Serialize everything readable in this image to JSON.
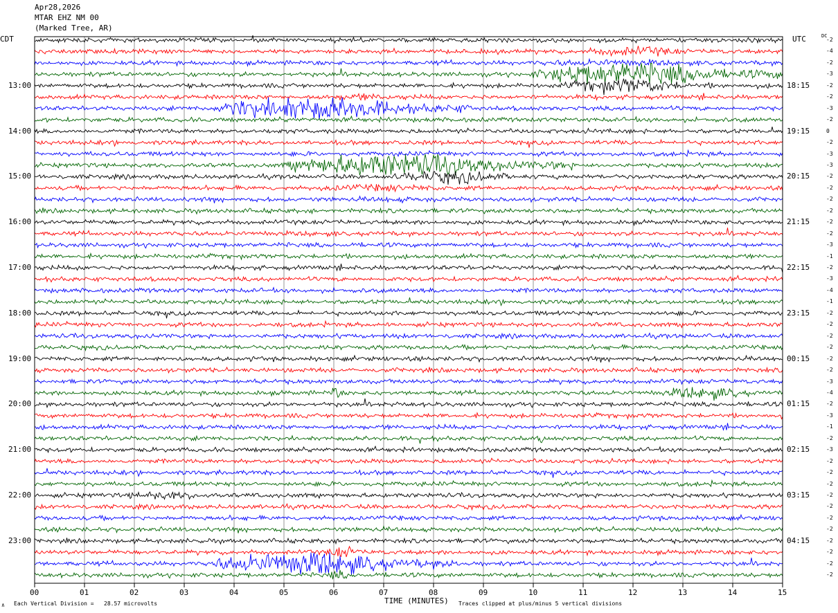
{
  "header": {
    "date": "Apr28,2026",
    "station": "MTAR EHZ NM 00",
    "location": "(Marked Tree, AR)"
  },
  "left_tz": "CDT",
  "right_tz": "UTC",
  "dc_label": "DC",
  "footer": {
    "scale_note": "Each Vertical Division =   28.57 microvolts",
    "clip_note": "Traces clipped at plus/minus 5 vertical divisions",
    "corner_mark": "∧"
  },
  "colors": {
    "black": "#000000",
    "red": "#ff0000",
    "blue": "#0000ff",
    "green": "#006400",
    "grid": "#7a7a7a"
  },
  "chart_data": {
    "type": "line",
    "title": "MTAR EHZ NM 00 helicorder, Apr28,2026",
    "xlabel": "TIME (MINUTES)",
    "ylabel": "",
    "xlim": [
      0,
      15
    ],
    "x_ticks": [
      "00",
      "01",
      "02",
      "03",
      "04",
      "05",
      "06",
      "07",
      "08",
      "09",
      "10",
      "11",
      "12",
      "13",
      "14",
      "15"
    ],
    "trace_color_cycle": [
      "black",
      "red",
      "blue",
      "green"
    ],
    "left_hour_labels": [
      "13:00",
      "14:00",
      "15:00",
      "16:00",
      "17:00",
      "18:00",
      "19:00",
      "20:00",
      "21:00",
      "22:00",
      "23:00"
    ],
    "right_hour_labels": [
      "18:15",
      "19:15",
      "20:15",
      "21:15",
      "22:15",
      "23:15",
      "00:15",
      "01:15",
      "02:15",
      "03:15",
      "04:15"
    ],
    "dc_offsets": [
      -2,
      -4,
      -2,
      -3,
      -2,
      -2,
      -3,
      -2,
      0,
      -2,
      -3,
      -3,
      -2,
      -2,
      -2,
      -2,
      -2,
      -2,
      -3,
      -1,
      -2,
      -3,
      -4,
      -1,
      -2,
      -2,
      -2,
      -2,
      -2,
      -2,
      -3,
      -4,
      -2,
      -3,
      -1,
      -2,
      -3,
      -2,
      -2,
      -2,
      -2,
      -2,
      -2,
      -2,
      -2,
      -2,
      -2,
      -2
    ],
    "events": [
      {
        "trace": 3,
        "start_min": 10.0,
        "end_min": 15.0,
        "amplitude_div": 5
      },
      {
        "trace": 4,
        "start_min": 10.5,
        "end_min": 14.0,
        "amplitude_div": 3
      },
      {
        "trace": 1,
        "start_min": 10.8,
        "end_min": 14.0,
        "amplitude_div": 2
      },
      {
        "trace": 2,
        "start_min": 9.5,
        "end_min": 14.5,
        "amplitude_div": 1.5
      },
      {
        "trace": 6,
        "start_min": 3.5,
        "end_min": 8.8,
        "amplitude_div": 5
      },
      {
        "trace": 5,
        "start_min": 5.5,
        "end_min": 8.5,
        "amplitude_div": 1.5
      },
      {
        "trace": 11,
        "start_min": 5.0,
        "end_min": 10.8,
        "amplitude_div": 5
      },
      {
        "trace": 12,
        "start_min": 7.0,
        "end_min": 10.5,
        "amplitude_div": 2.5
      },
      {
        "trace": 13,
        "start_min": 5.0,
        "end_min": 10.0,
        "amplitude_div": 1.5
      },
      {
        "trace": 14,
        "start_min": 6.0,
        "end_min": 9.5,
        "amplitude_div": 1.2
      },
      {
        "trace": 31,
        "start_min": 12.5,
        "end_min": 15.0,
        "amplitude_div": 2.5
      },
      {
        "trace": 31,
        "start_min": 5.9,
        "end_min": 6.2,
        "amplitude_div": 3
      },
      {
        "trace": 35,
        "start_min": 10.1,
        "end_min": 10.3,
        "amplitude_div": 2
      },
      {
        "trace": 40,
        "start_min": 1.6,
        "end_min": 4.2,
        "amplitude_div": 1.8
      },
      {
        "trace": 46,
        "start_min": 3.5,
        "end_min": 8.5,
        "amplitude_div": 5
      },
      {
        "trace": 45,
        "start_min": 5.8,
        "end_min": 6.8,
        "amplitude_div": 2.5
      },
      {
        "trace": 47,
        "start_min": 5.8,
        "end_min": 6.5,
        "amplitude_div": 2
      }
    ]
  }
}
